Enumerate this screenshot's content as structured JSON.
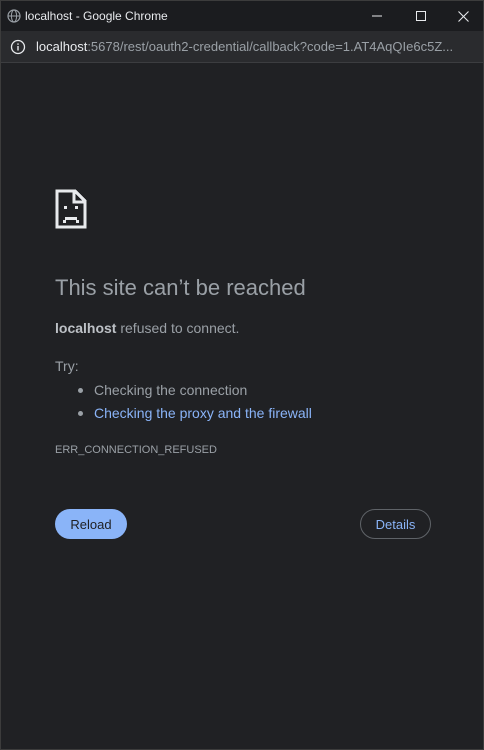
{
  "window": {
    "title": "localhost - Google Chrome",
    "favicon": "globe-icon",
    "controls": [
      "minimize-icon",
      "maximize-icon",
      "close-icon"
    ]
  },
  "address_bar": {
    "icon": "info-icon",
    "url_host": "localhost",
    "url_rest": ":5678/rest/oauth2-credential/callback?code=1.AT4AqQIe6c5Z..."
  },
  "error_page": {
    "icon": "sad-page-icon",
    "heading": "This site can’t be reached",
    "host": "localhost",
    "refused_text": " refused to connect.",
    "try_label": "Try:",
    "suggestions": [
      "Checking the connection",
      "Checking the proxy and the firewall"
    ],
    "error_code": "ERR_CONNECTION_REFUSED",
    "reload_label": "Reload",
    "details_label": "Details"
  },
  "colors": {
    "background": "#202124",
    "text": "#9aa0a6",
    "link": "#8ab4f8",
    "button": "#8ab4f8"
  }
}
